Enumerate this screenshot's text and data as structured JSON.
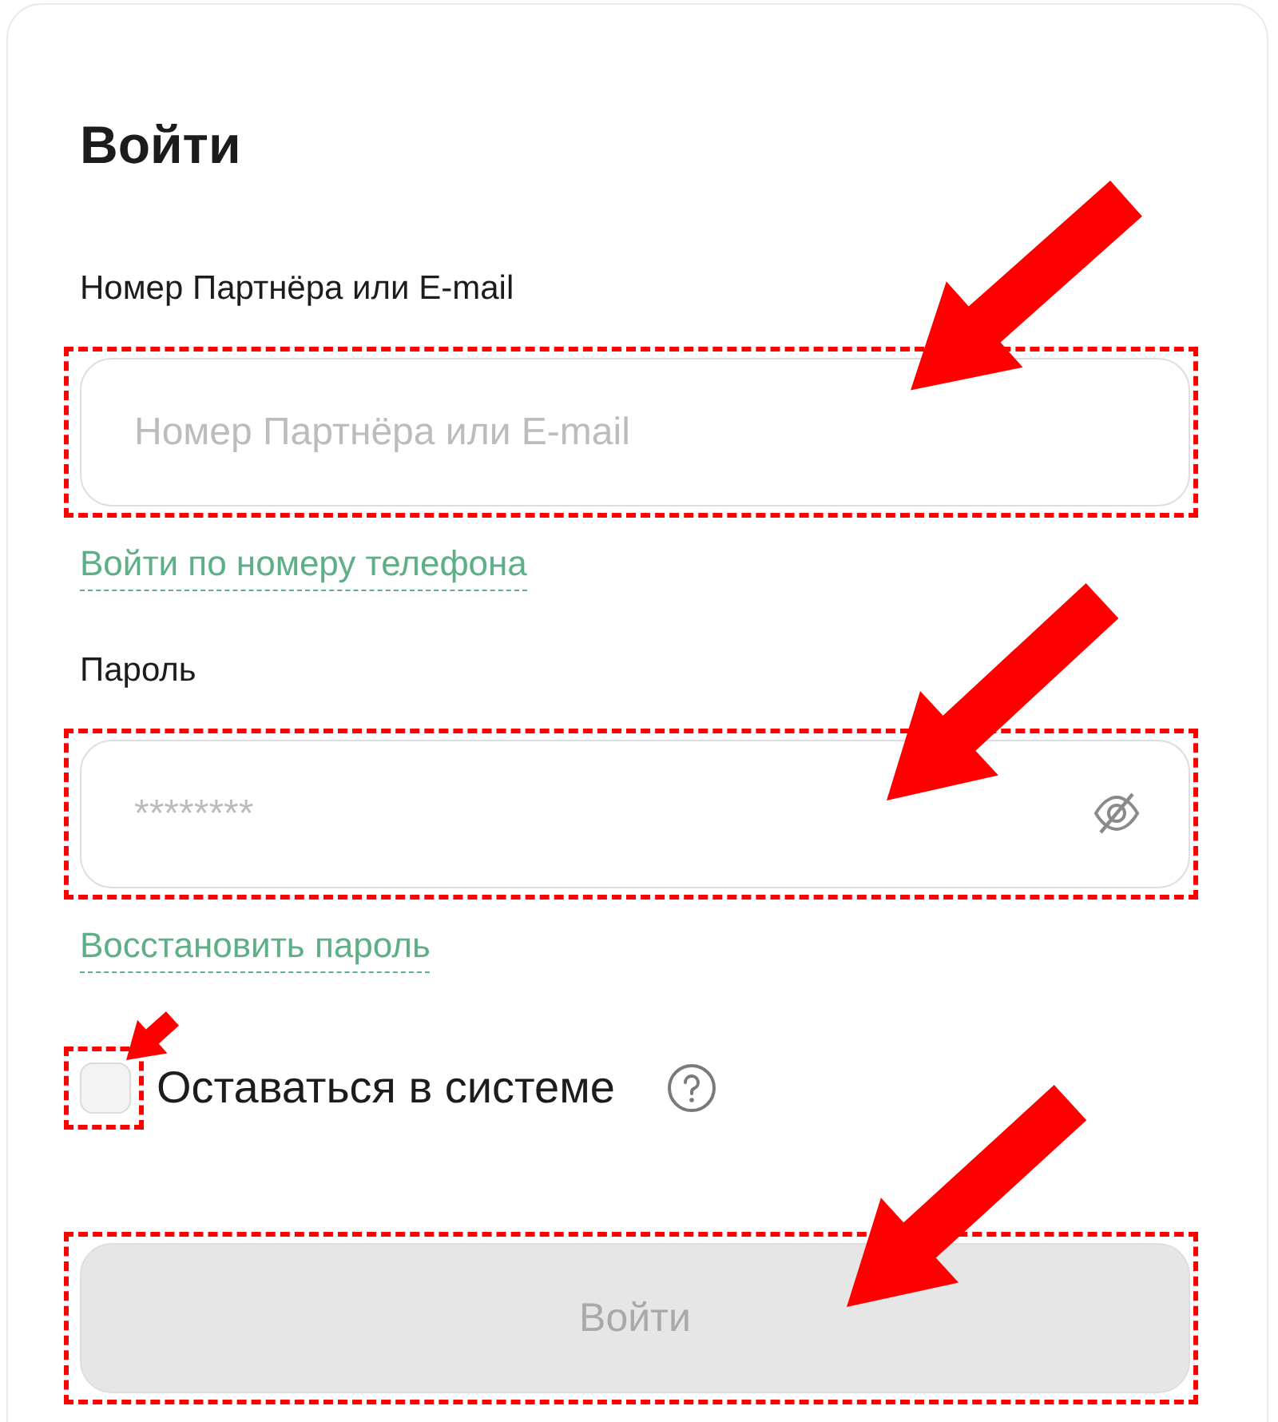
{
  "title": "Войти",
  "login": {
    "label": "Номер Партнёра или E-mail",
    "placeholder": "Номер Партнёра или E-mail",
    "highlighted": true
  },
  "phone_link": "Войти по номеру телефона",
  "password": {
    "label": "Пароль",
    "placeholder": "********",
    "password_visible": false,
    "highlighted": true
  },
  "recover_link": "Восстановить пароль",
  "remember": {
    "label": "Оставаться в системе",
    "checked": false,
    "highlighted": true
  },
  "submit": {
    "label": "Войти",
    "disabled": true,
    "highlighted": true
  }
}
